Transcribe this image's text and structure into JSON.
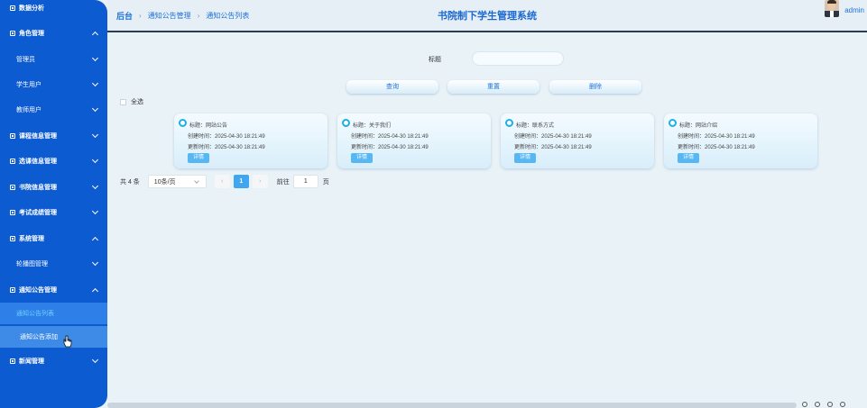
{
  "sidebar": {
    "items": [
      {
        "label": "数据分析",
        "type": "menu",
        "chevron": "none"
      },
      {
        "label": "角色管理",
        "type": "menu",
        "chevron": "up"
      },
      {
        "label": "管理员",
        "type": "sub",
        "chevron": "down"
      },
      {
        "label": "学生用户",
        "type": "sub",
        "chevron": "down"
      },
      {
        "label": "教师用户",
        "type": "sub",
        "chevron": "down"
      },
      {
        "label": "课程信息管理",
        "type": "menu",
        "chevron": "down"
      },
      {
        "label": "选课信息管理",
        "type": "menu",
        "chevron": "down"
      },
      {
        "label": "书院信息管理",
        "type": "menu",
        "chevron": "down"
      },
      {
        "label": "考试成绩管理",
        "type": "menu",
        "chevron": "down"
      },
      {
        "label": "系统管理",
        "type": "menu",
        "chevron": "up"
      },
      {
        "label": "轮播图管理",
        "type": "sub",
        "chevron": "down"
      },
      {
        "label": "通知公告管理",
        "type": "menu",
        "chevron": "up"
      },
      {
        "label": "通知公告列表",
        "type": "leaf-active",
        "chevron": "none"
      },
      {
        "label": "通知公告添加",
        "type": "leaf-hover",
        "chevron": "none"
      },
      {
        "label": "新闻管理",
        "type": "menu",
        "chevron": "down"
      }
    ]
  },
  "header": {
    "breadcrumb": [
      "后台",
      "通知公告管理",
      "通知公告列表"
    ],
    "title": "书院制下学生管理系统",
    "user": "admin"
  },
  "search": {
    "label": "标题",
    "value": "",
    "buttons": [
      "查询",
      "重置",
      "删除"
    ],
    "select_all": "全选"
  },
  "cards": [
    {
      "title": "标题：网站公告",
      "created": "创建时间：2025-04-30 18:21:49",
      "updated": "更新时间：2025-04-30 18:21:49",
      "detail": "详情"
    },
    {
      "title": "标题：关于我们",
      "created": "创建时间：2025-04-30 18:21:49",
      "updated": "更新时间：2025-04-30 18:21:49",
      "detail": "详情"
    },
    {
      "title": "标题：联系方式",
      "created": "创建时间：2025-04-30 18:21:49",
      "updated": "更新时间：2025-04-30 18:21:49",
      "detail": "详情"
    },
    {
      "title": "标题：网站介绍",
      "created": "创建时间：2025-04-30 18:21:49",
      "updated": "更新时间：2025-04-30 18:21:49",
      "detail": "详情"
    }
  ],
  "pagination": {
    "total": "共 4 条",
    "page_size": "10条/页",
    "prev": "‹",
    "current": "1",
    "next": "›",
    "goto_label": "前往",
    "goto_value": "1",
    "page_suffix": "页"
  }
}
